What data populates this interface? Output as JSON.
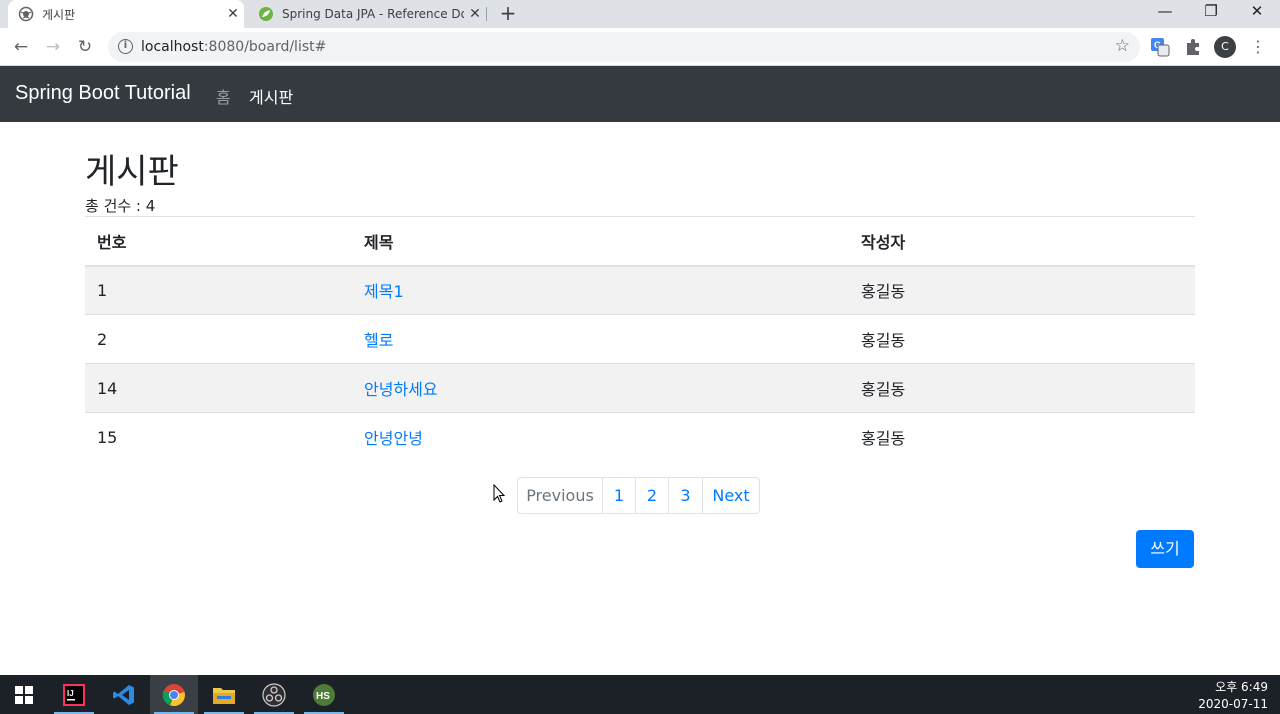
{
  "browser": {
    "tabs": [
      {
        "title": "게시판",
        "active": true
      },
      {
        "title": "Spring Data JPA - Reference Do",
        "active": false
      }
    ],
    "url_host": "localhost",
    "url_rest": ":8080/board/list#",
    "avatar_letter": "C"
  },
  "navbar": {
    "brand": "Spring Boot Tutorial",
    "links": [
      {
        "label": "홈",
        "active": false
      },
      {
        "label": "게시판",
        "active": true
      }
    ]
  },
  "page": {
    "title": "게시판",
    "total_label": "총 건수 : 4"
  },
  "table": {
    "headers": [
      "번호",
      "제목",
      "작성자"
    ],
    "rows": [
      {
        "id": "1",
        "title": "제목1",
        "author": "홍길동"
      },
      {
        "id": "2",
        "title": "헬로",
        "author": "홍길동"
      },
      {
        "id": "14",
        "title": "안녕하세요",
        "author": "홍길동"
      },
      {
        "id": "15",
        "title": "안녕안녕",
        "author": "홍길동"
      }
    ]
  },
  "pagination": {
    "previous": "Previous",
    "pages": [
      "1",
      "2",
      "3"
    ],
    "next": "Next"
  },
  "write_button": "쓰기",
  "taskbar": {
    "apps": [
      "windows-start-icon",
      "intellij-icon",
      "vscode-icon",
      "chrome-icon",
      "file-explorer-icon",
      "obs-icon",
      "hs-app-icon"
    ],
    "time": "오후 6:49",
    "date": "2020-07-11"
  },
  "colors": {
    "navbar": "#343a40",
    "link": "#007bff",
    "button": "#007bff"
  }
}
